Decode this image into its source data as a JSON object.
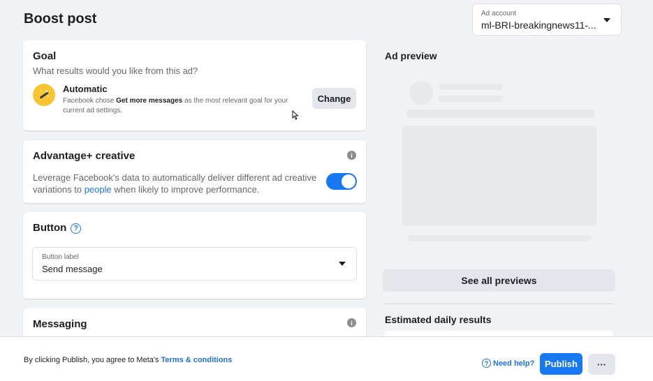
{
  "page": {
    "title": "Boost post"
  },
  "ad_account": {
    "label": "Ad account",
    "value": "ml-BRI-breakingnews11-..."
  },
  "goal": {
    "title": "Goal",
    "subtitle": "What results would you like from this ad?",
    "option_name": "Automatic",
    "desc_prefix": "Facebook chose ",
    "desc_bold": "Get more messages",
    "desc_suffix": " as the most relevant goal for your current ad settings.",
    "change_label": "Change",
    "icon": "magic-wand-icon"
  },
  "advantage": {
    "title": "Advantage+ creative",
    "desc_prefix": "Leverage Facebook's data to automatically deliver different ad creative variations to ",
    "desc_link": "people",
    "desc_suffix": " when likely to improve performance.",
    "info": "i",
    "toggle_on": true
  },
  "button_section": {
    "title": "Button",
    "help": "?",
    "select_label": "Button label",
    "select_value": "Send message"
  },
  "messaging": {
    "title": "Messaging",
    "info": "i"
  },
  "preview": {
    "title": "Ad preview",
    "see_all_label": "See all previews",
    "estimated_title": "Estimated daily results"
  },
  "footer": {
    "terms_prefix": "By clicking Publish, you agree to Meta's ",
    "terms_link": "Terms & conditions",
    "need_help": "Need help?",
    "help_q": "?",
    "publish_label": "Publish",
    "more_label": "···"
  },
  "colors": {
    "accent": "#1877f2",
    "link": "#216fdb",
    "goal_icon_bg": "#f7c531"
  }
}
